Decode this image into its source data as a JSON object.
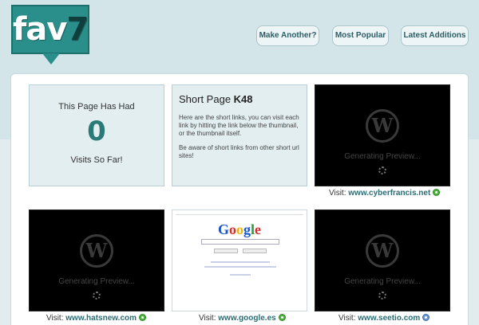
{
  "logo": {
    "text": "fav",
    "digit": "7"
  },
  "nav": [
    {
      "label": "Make Another?"
    },
    {
      "label": "Most Popular"
    },
    {
      "label": "Latest Additions"
    }
  ],
  "counter": {
    "title": "This Page Has Had",
    "value": "0",
    "footer": "Visits So Far!"
  },
  "short_page": {
    "title_prefix": "Short Page",
    "code": "K48",
    "paragraph1": "Here are the short links, you can visit each link by hitting the link below the thumbnail, or the thumbnail itself.",
    "paragraph2": "Be aware of short links from other short url sites!"
  },
  "thumbnails": [
    {
      "type": "generating",
      "text": "Generating Preview...",
      "visit_label": "Visit:",
      "site": "www.cyberfrancis.net",
      "icon": "go-icon"
    },
    {
      "type": "generating",
      "text": "Generating Preview...",
      "visit_label": "Visit:",
      "site": "www.hatsnew.com",
      "icon": "go-icon"
    },
    {
      "type": "google",
      "logo_letters": [
        "G",
        "o",
        "o",
        "g",
        "l",
        "e"
      ],
      "visit_label": "Visit:",
      "site": "www.google.es",
      "icon": "go-icon"
    },
    {
      "type": "generating",
      "text": "Generating Preview...",
      "visit_label": "Visit:",
      "site": "www.seetio.com",
      "icon": "globe-icon"
    }
  ],
  "wp_glyph": "W"
}
